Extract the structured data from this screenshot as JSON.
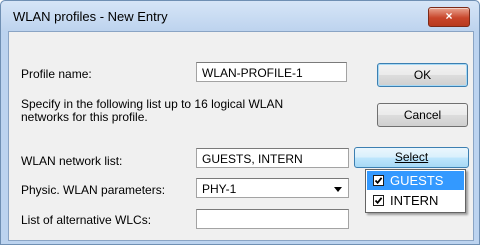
{
  "window": {
    "title": "WLAN profiles - New Entry",
    "close_glyph": "×"
  },
  "form": {
    "profile_name_label": "Profile name:",
    "profile_name_value": "WLAN-PROFILE-1",
    "description": [
      "Specify in the following list up to 16 logical WLAN",
      "networks for this profile."
    ],
    "network_list_label": "WLAN network list:",
    "network_list_value": "GUESTS, INTERN",
    "physic_label": "Physic. WLAN parameters:",
    "physic_value": "PHY-1",
    "alt_wlc_label": "List of alternative WLCs:",
    "alt_wlc_value": ""
  },
  "buttons": {
    "ok": "OK",
    "cancel": "Cancel",
    "select": "Select"
  },
  "dropdown": {
    "items": [
      {
        "label": "GUESTS",
        "checked": true,
        "highlighted": true
      },
      {
        "label": "INTERN",
        "checked": true,
        "highlighted": false
      }
    ]
  },
  "colors": {
    "highlight": "#3399ff",
    "title_bar": "#bdd3ee",
    "close_button": "#c8462b"
  }
}
